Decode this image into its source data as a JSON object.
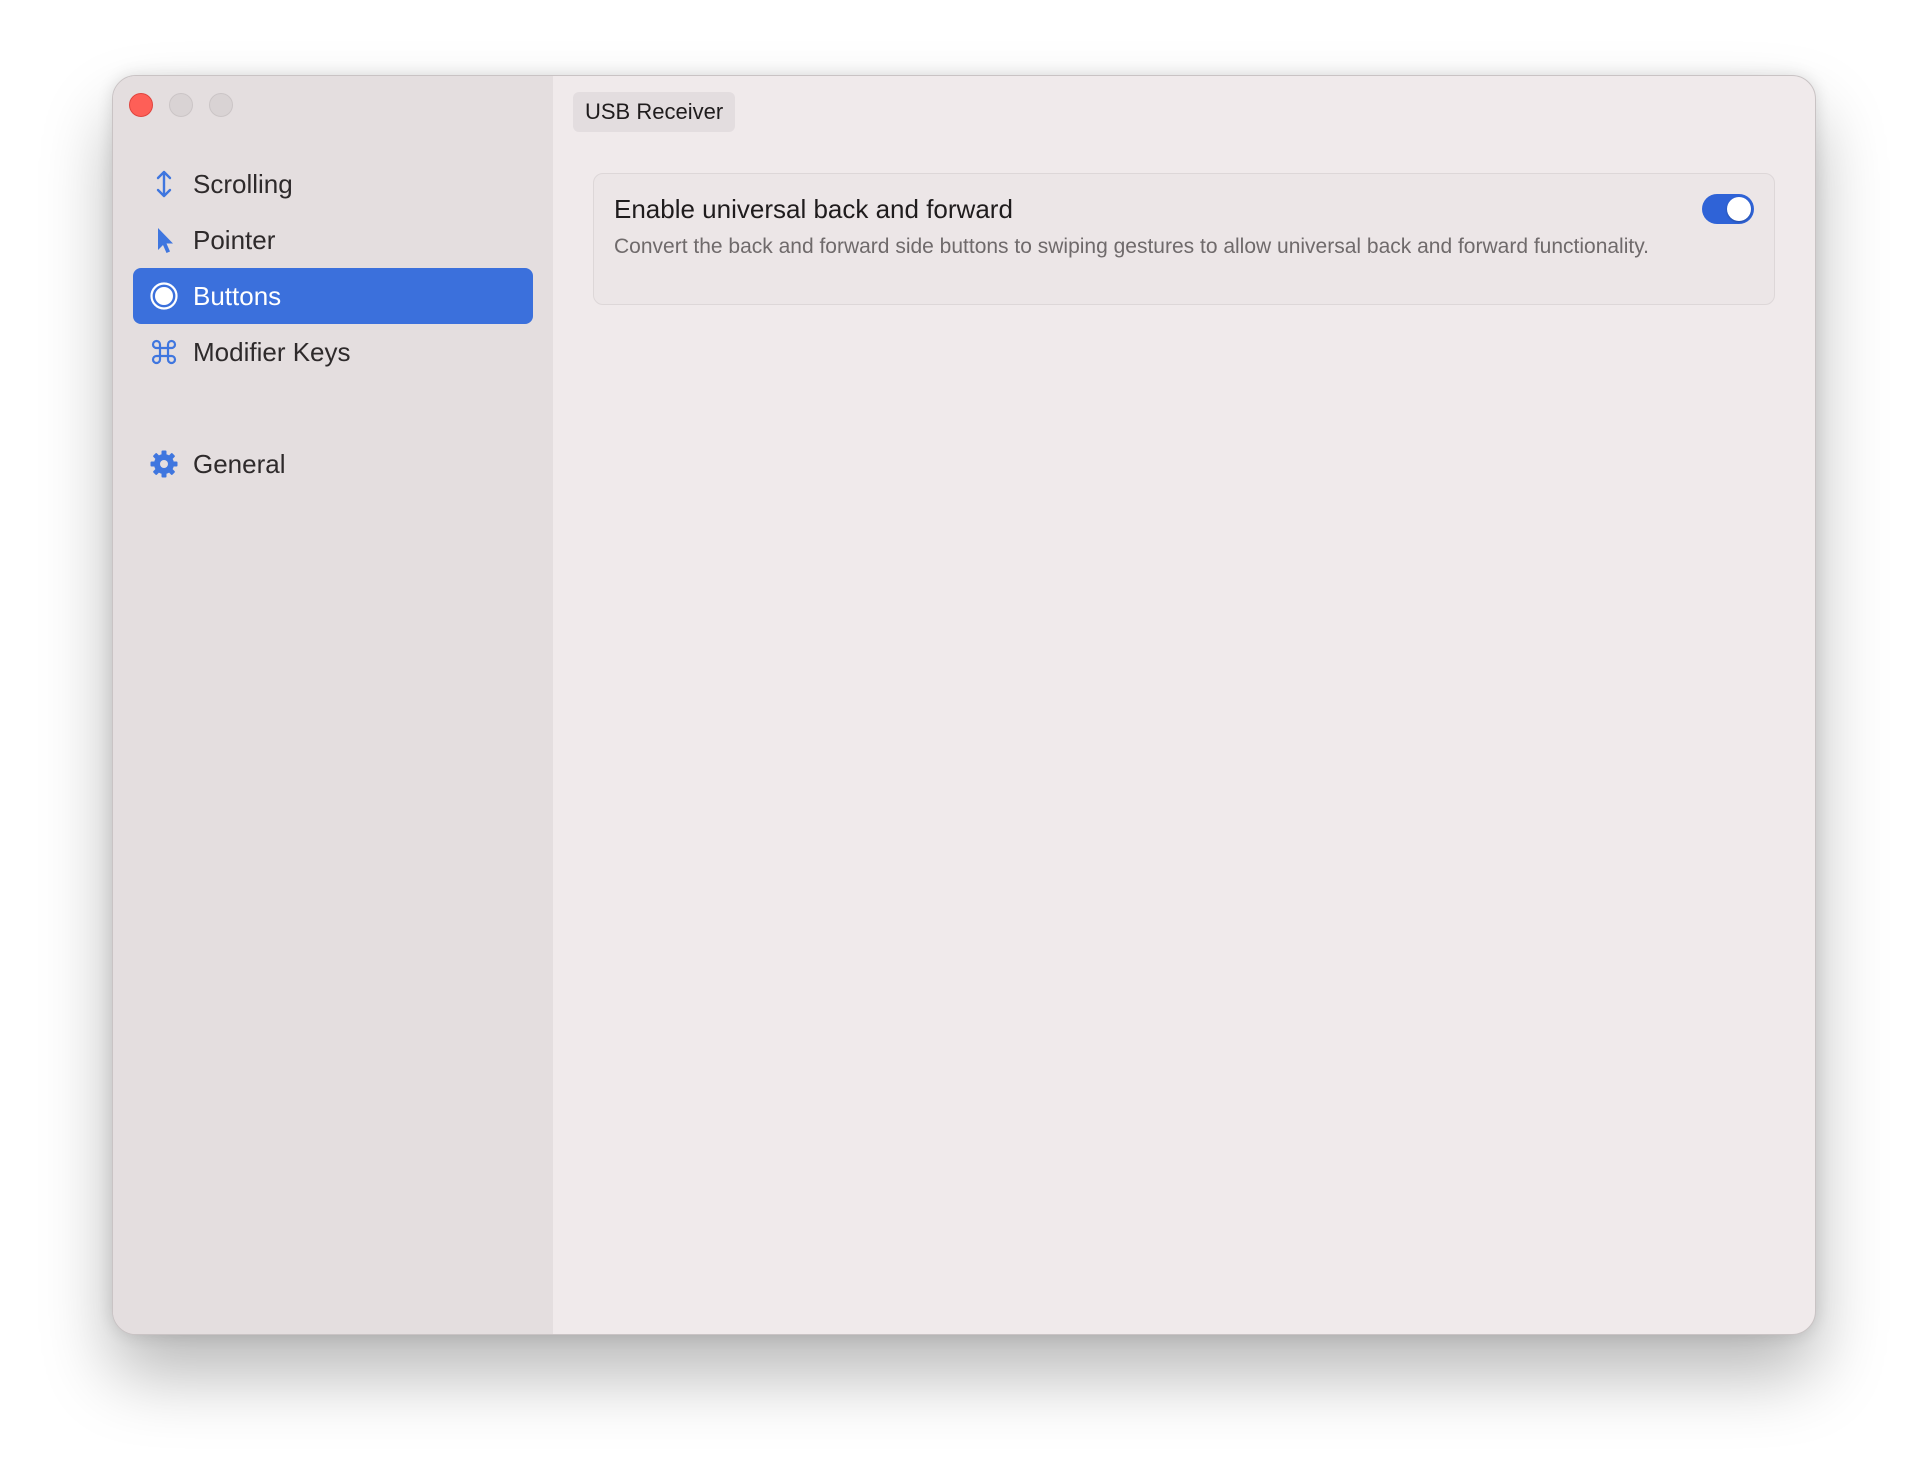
{
  "colors": {
    "accent": "#3b70dc",
    "toggle_on": "#2f63d7",
    "icon": "#3f76df",
    "close": "#fe5f57"
  },
  "sidebar": {
    "items": [
      {
        "label": "Scrolling",
        "icon": "vertical-arrows-icon",
        "selected": false
      },
      {
        "label": "Pointer",
        "icon": "cursor-arrow-icon",
        "selected": false
      },
      {
        "label": "Buttons",
        "icon": "circle-button-icon",
        "selected": true
      },
      {
        "label": "Modifier Keys",
        "icon": "command-key-icon",
        "selected": false
      }
    ],
    "footer_items": [
      {
        "label": "General",
        "icon": "gear-icon",
        "selected": false
      }
    ]
  },
  "header": {
    "device_name": "USB Receiver"
  },
  "settings": {
    "universal_back_forward": {
      "title": "Enable universal back and forward",
      "description": "Convert the back and forward side buttons to swiping gestures to allow universal back and forward functionality.",
      "enabled": true
    }
  }
}
